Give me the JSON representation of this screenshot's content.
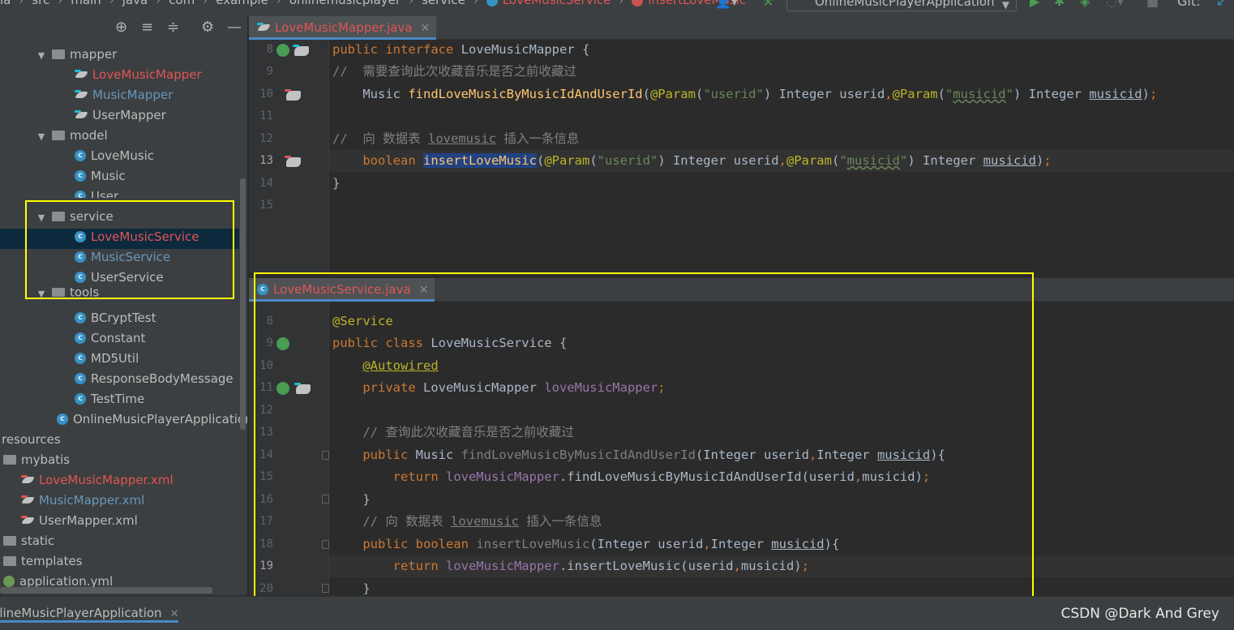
{
  "breadcrumbs": [
    "ia",
    "src",
    "main",
    "java",
    "com",
    "example",
    "onlinemusicplayer",
    "service",
    "LoveMusicService",
    "insertLoveMusic"
  ],
  "run_config": "OnlineMusicPlayerApplication",
  "git_label": "Git:",
  "tree": {
    "items": [
      {
        "label": "mapper",
        "kind": "folder",
        "expanded": true
      },
      {
        "label": "LoveMusicMapper",
        "kind": "mapper",
        "color": "red"
      },
      {
        "label": "MusicMapper",
        "kind": "mapper",
        "color": "blue"
      },
      {
        "label": "UserMapper",
        "kind": "mapper",
        "color": "normal"
      },
      {
        "label": "model",
        "kind": "folder",
        "expanded": true
      },
      {
        "label": "LoveMusic",
        "kind": "class",
        "color": "normal"
      },
      {
        "label": "Music",
        "kind": "class",
        "color": "normal"
      },
      {
        "label": "User",
        "kind": "class",
        "color": "normal"
      },
      {
        "label": "service",
        "kind": "folder",
        "expanded": true
      },
      {
        "label": "LoveMusicService",
        "kind": "class",
        "color": "red",
        "selected": true
      },
      {
        "label": "MusicService",
        "kind": "class",
        "color": "blue"
      },
      {
        "label": "UserService",
        "kind": "class",
        "color": "normal"
      },
      {
        "label": "tools",
        "kind": "folder",
        "expanded": true
      },
      {
        "label": "BCryptTest",
        "kind": "class",
        "color": "normal"
      },
      {
        "label": "Constant",
        "kind": "class",
        "color": "normal"
      },
      {
        "label": "MD5Util",
        "kind": "class",
        "color": "normal"
      },
      {
        "label": "ResponseBodyMessage",
        "kind": "class",
        "color": "normal"
      },
      {
        "label": "TestTime",
        "kind": "class",
        "color": "normal"
      },
      {
        "label": "OnlineMusicPlayerApplication",
        "kind": "class",
        "color": "normal"
      },
      {
        "label": "resources",
        "kind": "folder",
        "color": "normal"
      },
      {
        "label": "mybatis",
        "kind": "folder",
        "color": "normal"
      },
      {
        "label": "LoveMusicMapper.xml",
        "kind": "mapper",
        "color": "red"
      },
      {
        "label": "MusicMapper.xml",
        "kind": "mapper",
        "color": "blue"
      },
      {
        "label": "UserMapper.xml",
        "kind": "mapper",
        "color": "normal"
      },
      {
        "label": "static",
        "kind": "folder",
        "color": "normal"
      },
      {
        "label": "templates",
        "kind": "folder",
        "color": "normal"
      },
      {
        "label": "application.yml",
        "kind": "file",
        "color": "normal"
      }
    ]
  },
  "editor_top": {
    "tab": "LoveMusicMapper.java",
    "line_numbers": [
      "8",
      "9",
      "10",
      "11",
      "12",
      "13",
      "14",
      "15"
    ],
    "current_line": "13"
  },
  "editor_bottom": {
    "tab": "LoveMusicService.java",
    "line_numbers": [
      "8",
      "9",
      "10",
      "11",
      "12",
      "13",
      "14",
      "15",
      "16",
      "17",
      "18",
      "19",
      "20"
    ],
    "current_line": "19"
  },
  "bottom_bar": {
    "run_tab": "OnlineMusicPlayerApplication",
    "watermark": "CSDN @Dark And Grey"
  },
  "colors": {
    "keyword": "#cc7832",
    "annotation": "#bbb529",
    "string": "#6a8759",
    "comment": "#808080",
    "field": "#9876aa",
    "method": "#ffc66d",
    "highlight_box": "#ffff00",
    "vcs_modified_red": "#e05555",
    "vcs_modified_blue": "#6897bb"
  }
}
